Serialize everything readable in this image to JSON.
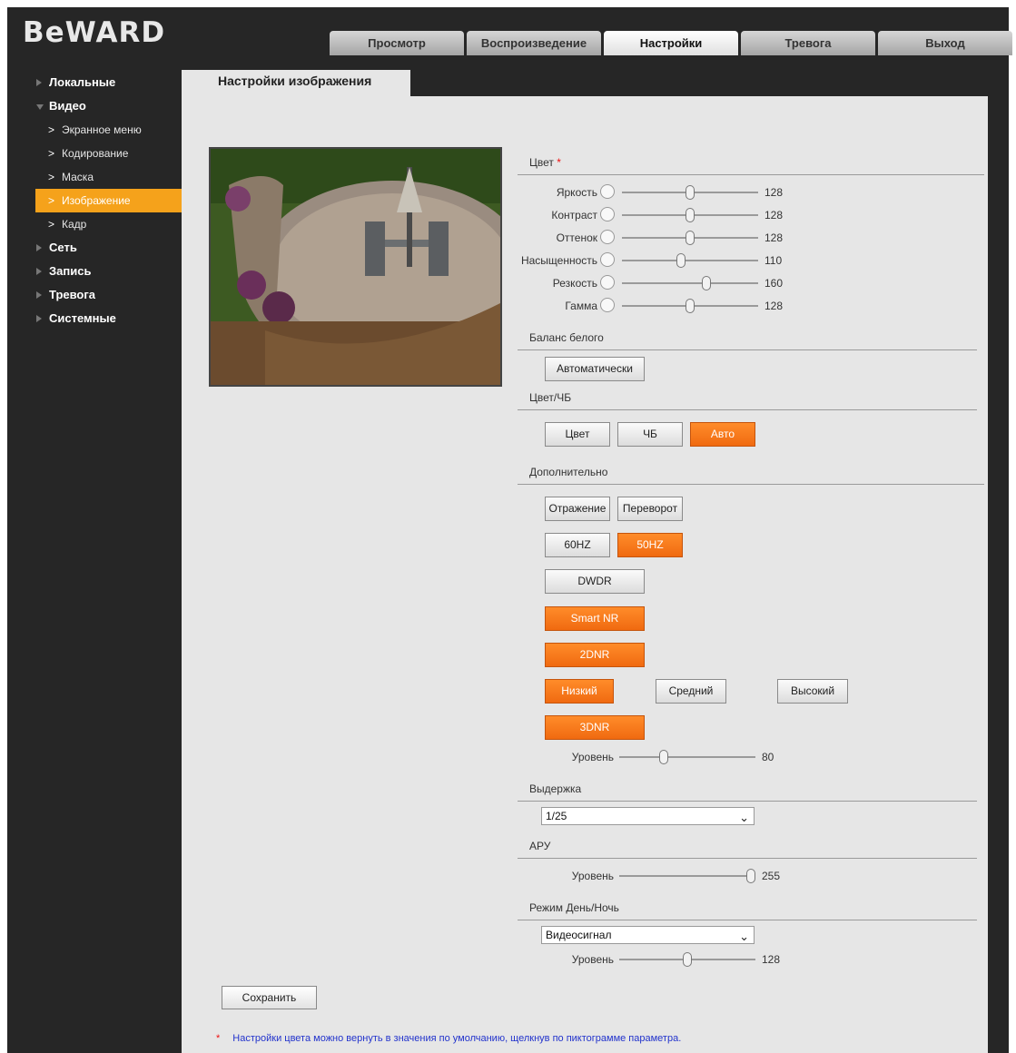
{
  "brand": "BeWARD",
  "tabs": [
    "Просмотр",
    "Воспроизведение",
    "Настройки",
    "Тревога",
    "Выход"
  ],
  "active_tab": "Настройки",
  "sidebar": {
    "items": [
      {
        "label": "Локальные"
      },
      {
        "label": "Видео",
        "children": [
          "Экранное меню",
          "Кодирование",
          "Маска",
          "Изображение",
          "Кадр"
        ]
      },
      {
        "label": "Сеть"
      },
      {
        "label": "Запись"
      },
      {
        "label": "Тревога"
      },
      {
        "label": "Системные"
      }
    ],
    "active_sub": "Изображение"
  },
  "page_title": "Настройки изображения",
  "color": {
    "title": "Цвет",
    "required_mark": "*",
    "sliders": [
      {
        "label": "Яркость",
        "icon": "brightness-icon",
        "value": 128,
        "max": 255
      },
      {
        "label": "Контраст",
        "icon": "contrast-icon",
        "value": 128,
        "max": 255
      },
      {
        "label": "Оттенок",
        "icon": "hue-icon",
        "value": 128,
        "max": 255
      },
      {
        "label": "Насыщенность",
        "icon": "saturation-icon",
        "value": 110,
        "max": 255
      },
      {
        "label": "Резкость",
        "icon": "sharpness-icon",
        "value": 160,
        "max": 255
      },
      {
        "label": "Гамма",
        "icon": "gamma-icon",
        "value": 128,
        "max": 255
      }
    ]
  },
  "white_balance": {
    "title": "Баланс белого",
    "button": "Автоматически"
  },
  "color_bw": {
    "title": "Цвет/ЧБ",
    "buttons": [
      "Цвет",
      "ЧБ",
      "Авто"
    ],
    "active": "Авто"
  },
  "extra": {
    "title": "Дополнительно",
    "mirror": "Отражение",
    "flip": "Переворот",
    "freq": [
      "60HZ",
      "50HZ"
    ],
    "freq_active": "50HZ",
    "dwdr": "DWDR",
    "smart_nr": "Smart NR",
    "dnr2": "2DNR",
    "levels": [
      "Низкий",
      "Средний",
      "Высокий"
    ],
    "level_active": "Низкий",
    "dnr3": "3DNR",
    "dnr3_level_label": "Уровень",
    "dnr3_level": 80,
    "dnr3_max": 255
  },
  "shutter": {
    "title": "Выдержка",
    "value": "1/25"
  },
  "agc": {
    "title": "АРУ",
    "level_label": "Уровень",
    "value": 255,
    "max": 255
  },
  "day_night": {
    "title": "Режим День/Ночь",
    "mode": "Видеосигнал",
    "level_label": "Уровень",
    "value": 128,
    "max": 255
  },
  "save_label": "Сохранить",
  "footnote": {
    "mark": "*",
    "text": "Настройки цвета можно вернуть в значения по умолчанию, щелкнув по пиктограмме параметра."
  },
  "colors": {
    "accent_orange": "#f06a10",
    "sidebar_active": "#f5a21b",
    "background": "#262626",
    "panel": "#e6e6e6",
    "link_blue": "#2233cc"
  }
}
